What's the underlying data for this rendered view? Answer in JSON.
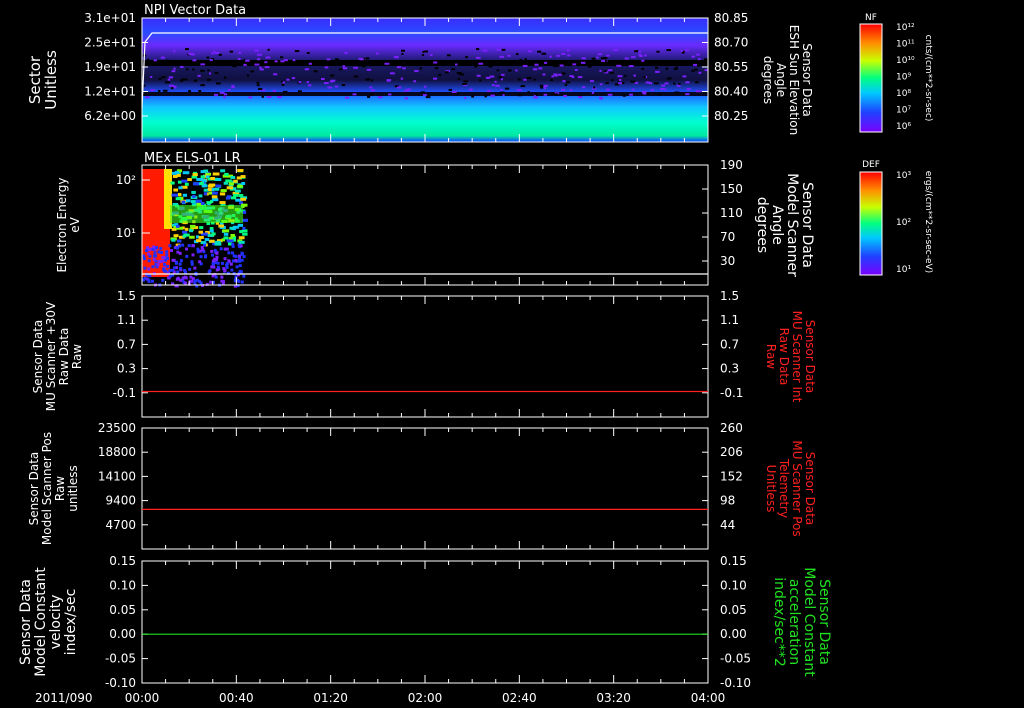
{
  "time_axis": {
    "date_label": "2011/090",
    "ticks": [
      "00:00",
      "00:40",
      "01:20",
      "02:00",
      "02:40",
      "03:20",
      "04:00"
    ]
  },
  "chart_data": [
    {
      "type": "heatmap",
      "title": "NPI Vector Data",
      "ylabel_left": [
        "Sector",
        "Unitless"
      ],
      "yticks_left": [
        "3.1e+01",
        "2.5e+01",
        "1.9e+01",
        "1.2e+01",
        "6.2e+00"
      ],
      "ylabel_right": [
        "Sensor Data",
        "ESH Sun Elevation",
        "Angle",
        "degrees"
      ],
      "yticks_right": [
        "80.85",
        "80.70",
        "80.55",
        "80.40",
        "80.25"
      ],
      "line_y_right": 80.8,
      "colorbar": {
        "label": "NF",
        "units": "cnts/(cm**2-sr-sec)",
        "ticks": [
          "10¹²",
          "10¹¹",
          "10¹⁰",
          "10⁹",
          "10⁸",
          "10⁷",
          "10⁶"
        ]
      }
    },
    {
      "type": "heatmap",
      "title": "MEx ELS-01 LR",
      "ylabel_left": [
        "Electron Energy",
        "eV"
      ],
      "yticks_left": [
        "10²",
        "10¹"
      ],
      "ylabel_right": [
        "Sensor Data",
        "Model Scanner",
        "Angle",
        "degrees"
      ],
      "yticks_right": [
        "190",
        "150",
        "110",
        "70",
        "30"
      ],
      "line_y_right": 10,
      "data_extent": [
        "00:00",
        "00:12"
      ],
      "colorbar": {
        "label": "DEF",
        "units": "ergs/(cm**2-sr-sec-eV)",
        "ticks": [
          "10³",
          "10²",
          "10¹"
        ]
      }
    },
    {
      "type": "line",
      "ylabel_left": [
        "Sensor Data",
        "MU Scanner +30V",
        "Raw Data",
        "Raw"
      ],
      "yticks_left": [
        "1.5",
        "1.1",
        "0.7",
        "0.3",
        "-0.1"
      ],
      "ylabel_right": [
        "Sensor Data",
        "MU Scanner Int",
        "Raw Data",
        "Raw"
      ],
      "yticks_right": [
        "1.5",
        "1.1",
        "0.7",
        "0.3",
        "-0.1"
      ],
      "ylim": [
        -0.4,
        1.5
      ],
      "series": [
        {
          "color": "#ff2020",
          "values": [
            0.0,
            0.0
          ]
        }
      ]
    },
    {
      "type": "line",
      "ylabel_left": [
        "Sensor Data",
        "Model Scanner Pos",
        "Raw",
        "unitless"
      ],
      "yticks_left": [
        "23500",
        "18800",
        "14100",
        "9400",
        "4700"
      ],
      "ylabel_right": [
        "Sensor Data",
        "MU Scanner Pos",
        "Telemetry",
        "Unitless"
      ],
      "yticks_right": [
        "260",
        "206",
        "152",
        "98",
        "44"
      ],
      "ylim": [
        0,
        23500
      ],
      "series": [
        {
          "color": "#ff2020",
          "values": [
            7700,
            7700
          ]
        }
      ]
    },
    {
      "type": "line",
      "ylabel_left": [
        "Sensor Data",
        "Model Constant",
        "velocity",
        "index/sec"
      ],
      "yticks_left": [
        "0.15",
        "0.10",
        "0.05",
        "0.00",
        "-0.05",
        "-0.10"
      ],
      "ylabel_right": [
        "Sensor Data",
        "Model Constant",
        "acceleration",
        "index/sec**2"
      ],
      "yticks_right": [
        "0.15",
        "0.10",
        "0.05",
        "0.00",
        "-0.05",
        "-0.10"
      ],
      "ylim": [
        -0.1,
        0.15
      ],
      "series": [
        {
          "color": "#20e020",
          "values": [
            0.0,
            0.0
          ]
        }
      ]
    }
  ],
  "colors": {
    "red_label": "#ff2020",
    "green_label": "#20e020"
  }
}
